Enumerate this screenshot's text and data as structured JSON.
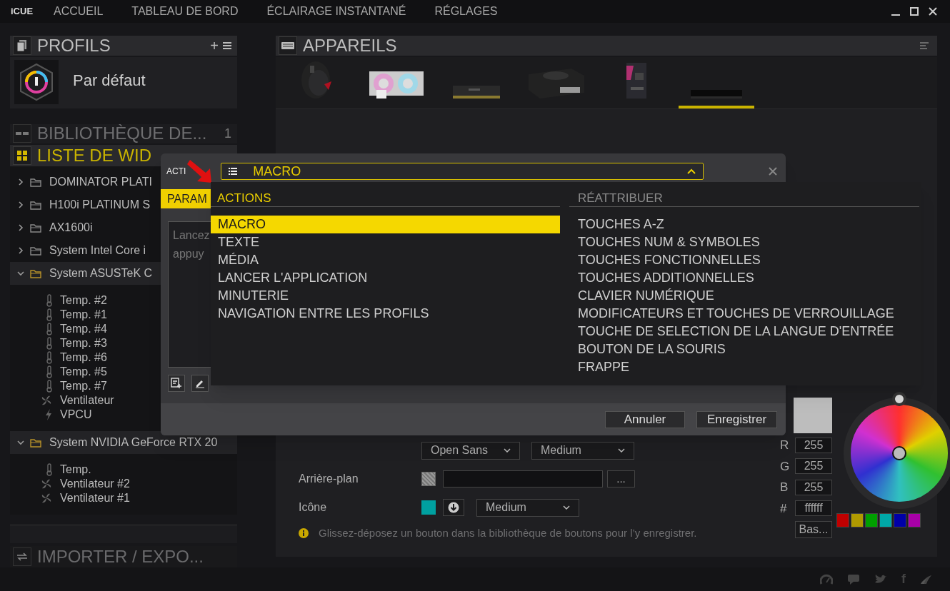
{
  "app": {
    "logo": "iCUE"
  },
  "nav": [
    {
      "label": "ACCUEIL",
      "selected": false
    },
    {
      "label": "TABLEAU DE BORD",
      "selected": false
    },
    {
      "label": "ÉCLAIRAGE INSTANTANÉ",
      "selected": false
    },
    {
      "label": "RÉGLAGES",
      "selected": false
    }
  ],
  "profiles": {
    "title": "PROFILS",
    "add": "+",
    "items": [
      {
        "name": "Par défaut"
      }
    ]
  },
  "library": {
    "title": "BIBLIOTHÈQUE DE...",
    "count": "1"
  },
  "widgets": {
    "title": "LISTE DE WID",
    "tree": [
      {
        "label": "DOMINATOR PLATI",
        "expanded": false
      },
      {
        "label": "H100i PLATINUM S",
        "expanded": false
      },
      {
        "label": "AX1600i",
        "expanded": false
      },
      {
        "label": "System Intel Core i",
        "expanded": false
      },
      {
        "label": "System ASUSTeK C",
        "expanded": true,
        "children": [
          {
            "kind": "temp",
            "label": "Temp. #2"
          },
          {
            "kind": "temp",
            "label": "Temp. #1"
          },
          {
            "kind": "temp",
            "label": "Temp. #4"
          },
          {
            "kind": "temp",
            "label": "Temp. #3"
          },
          {
            "kind": "temp",
            "label": "Temp. #6"
          },
          {
            "kind": "temp",
            "label": "Temp. #5"
          },
          {
            "kind": "temp",
            "label": "Temp. #7"
          },
          {
            "kind": "fan",
            "label": "Ventilateur"
          },
          {
            "kind": "power",
            "label": "VPCU"
          }
        ]
      },
      {
        "label": "System NVIDIA GeForce RTX 20",
        "expanded": true,
        "children": [
          {
            "kind": "temp",
            "label": "Temp."
          },
          {
            "kind": "fan",
            "label": "Ventilateur #2"
          },
          {
            "kind": "fan",
            "label": "Ventilateur #1"
          }
        ]
      }
    ]
  },
  "import_export": {
    "title": "IMPORTER / EXPO..."
  },
  "devices": {
    "title": "APPAREILS",
    "items": [
      {
        "kind": "mouse",
        "selected": false
      },
      {
        "kind": "cooler",
        "selected": false
      },
      {
        "kind": "memory",
        "selected": false
      },
      {
        "kind": "psu",
        "selected": false
      },
      {
        "kind": "board",
        "selected": false
      },
      {
        "kind": "bar",
        "selected": true
      }
    ]
  },
  "editor": {
    "font": "Open Sans",
    "weight": "Medium",
    "background_label": "Arrière-plan",
    "more": "...",
    "icon_label": "Icône",
    "icon_size": "Medium",
    "info": "Glissez-déposez un bouton dans la bibliothèque de boutons pour l’y enregistrer."
  },
  "color_picker": {
    "r": "255",
    "g": "255",
    "b": "255",
    "hex": "ffffff",
    "labels": [
      "R",
      "G",
      "B",
      "#"
    ],
    "basic": "Bas...",
    "palette": [
      {
        "color": "#c00000"
      },
      {
        "color": "#b09a00"
      },
      {
        "color": "#00a000"
      },
      {
        "color": "#00a8a8"
      },
      {
        "color": "#0000a8"
      },
      {
        "color": "#a800a8"
      }
    ]
  },
  "dialog": {
    "title": "ACTI",
    "tab": "PARAM",
    "hint_lines": [
      "Lancez",
      "appuy"
    ],
    "select": {
      "value": "MACRO",
      "expanded": true
    },
    "cancel": "Annuler",
    "save": "Enregistrer"
  },
  "dropdown": {
    "groups": [
      {
        "title": "ACTIONS",
        "selected": true,
        "items": [
          {
            "label": "MACRO",
            "selected": true
          },
          {
            "label": "TEXTE",
            "selected": false
          },
          {
            "label": "MÉDIA",
            "selected": false
          },
          {
            "label": "LANCER L'APPLICATION",
            "selected": false
          },
          {
            "label": "MINUTERIE",
            "selected": false
          },
          {
            "label": "NAVIGATION ENTRE LES PROFILS",
            "selected": false
          }
        ]
      },
      {
        "title": "RÉATTRIBUER",
        "selected": false,
        "items": [
          {
            "label": "TOUCHES A-Z",
            "selected": false
          },
          {
            "label": "TOUCHES NUM & SYMBOLES",
            "selected": false
          },
          {
            "label": "TOUCHES FONCTIONNELLES",
            "selected": false
          },
          {
            "label": "TOUCHES ADDITIONNELLES",
            "selected": false
          },
          {
            "label": "CLAVIER NUMÉRIQUE",
            "selected": false
          },
          {
            "label": "MODIFICATEURS ET TOUCHES DE VERROUILLAGE",
            "selected": false
          },
          {
            "label": "TOUCHE DE SELECTION DE LA LANGUE D'ENTRÉE",
            "selected": false
          },
          {
            "label": "BOUTON DE LA SOURIS",
            "selected": false
          },
          {
            "label": "FRAPPE",
            "selected": false
          }
        ]
      }
    ]
  },
  "status_bar": {
    "facebook": "f"
  }
}
